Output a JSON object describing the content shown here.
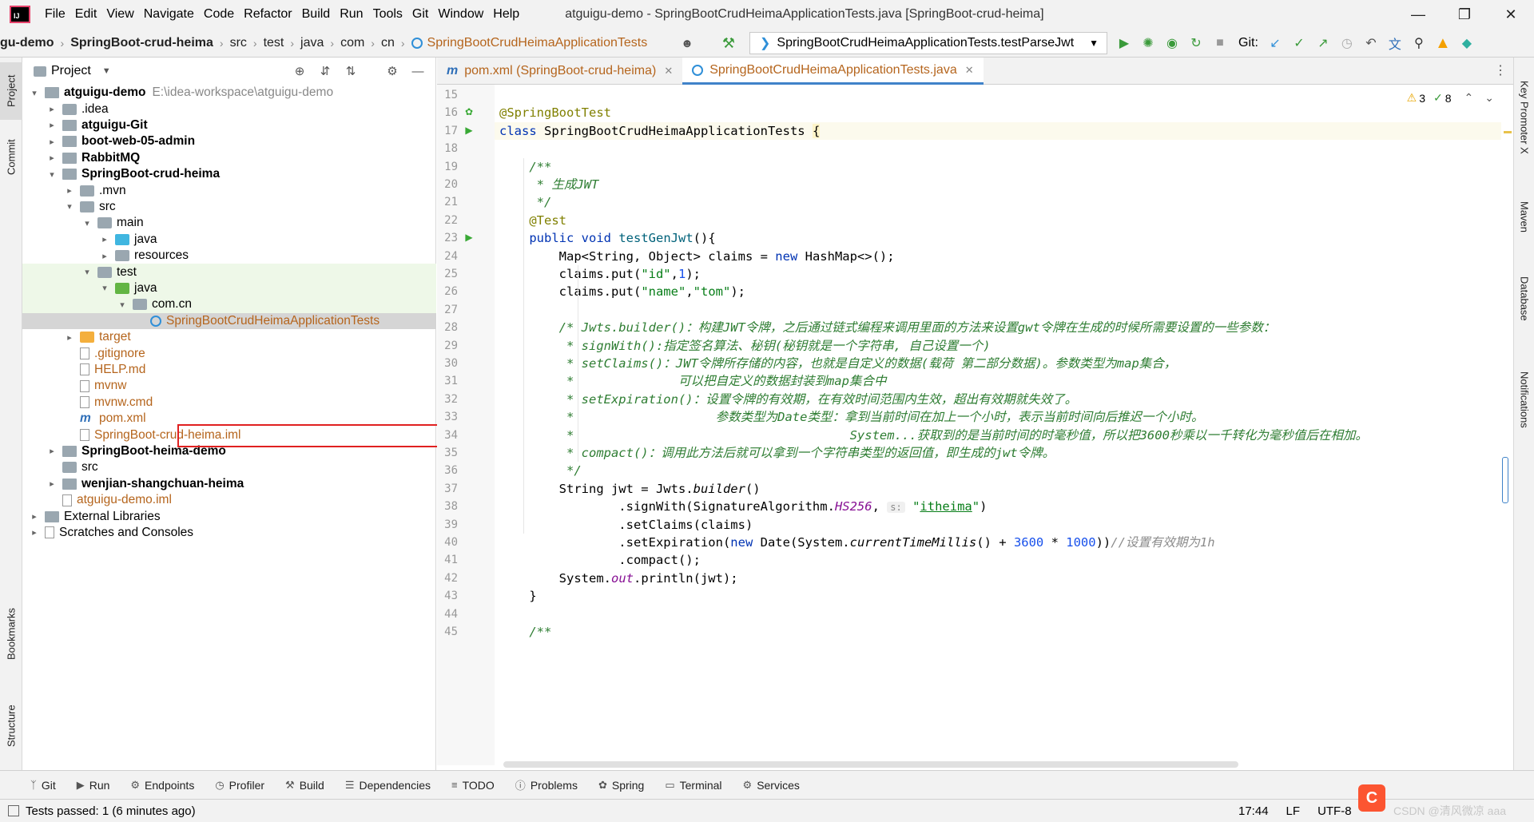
{
  "titlebar": {
    "menus": [
      "File",
      "Edit",
      "View",
      "Navigate",
      "Code",
      "Refactor",
      "Build",
      "Run",
      "Tools",
      "Git",
      "Window",
      "Help"
    ],
    "title": "atguigu-demo - SpringBootCrudHeimaApplicationTests.java [SpringBoot-crud-heima]"
  },
  "breadcrumb": {
    "items": [
      "gu-demo",
      "SpringBoot-crud-heima",
      "src",
      "test",
      "java",
      "com",
      "cn",
      "SpringBootCrudHeimaApplicationTests"
    ]
  },
  "toolbar": {
    "run_config": "SpringBootCrudHeimaApplicationTests.testParseJwt",
    "git_label": "Git:"
  },
  "left_stripe": [
    "Project",
    "Commit",
    "Bookmarks",
    "Structure"
  ],
  "right_stripe": [
    "Key Promoter X",
    "Maven",
    "Database",
    "Notifications"
  ],
  "project": {
    "header": "Project",
    "tree": [
      {
        "label": "atguigu-demo",
        "path": "E:\\idea-workspace\\atguigu-demo",
        "bold": true,
        "icon": "module",
        "arrow": "▾"
      },
      {
        "label": ".idea",
        "icon": "folder",
        "arrow": "▸"
      },
      {
        "label": "atguigu-Git",
        "bold": true,
        "icon": "module",
        "arrow": "▸"
      },
      {
        "label": "boot-web-05-admin",
        "bold": true,
        "icon": "module",
        "arrow": "▸"
      },
      {
        "label": "RabbitMQ",
        "bold": true,
        "icon": "module",
        "arrow": "▸"
      },
      {
        "label": "SpringBoot-crud-heima",
        "bold": true,
        "icon": "module",
        "arrow": "▾"
      },
      {
        "label": ".mvn",
        "icon": "folder",
        "arrow": "▸"
      },
      {
        "label": "src",
        "icon": "folder",
        "arrow": "▾"
      },
      {
        "label": "main",
        "icon": "folder",
        "arrow": "▾"
      },
      {
        "label": "java",
        "icon": "folder-blue",
        "arrow": "▸"
      },
      {
        "label": "resources",
        "icon": "folder",
        "arrow": "▸"
      },
      {
        "label": "test",
        "icon": "folder",
        "arrow": "▾"
      },
      {
        "label": "java",
        "icon": "folder-green",
        "arrow": "▾"
      },
      {
        "label": "com.cn",
        "icon": "package",
        "arrow": "▾"
      },
      {
        "label": "SpringBootCrudHeimaApplicationTests",
        "icon": "java-class",
        "arrow": "",
        "selected": true
      },
      {
        "label": "target",
        "icon": "folder-orange",
        "arrow": "▸",
        "orange": true
      },
      {
        "label": ".gitignore",
        "icon": "file",
        "arrow": "",
        "orange": true
      },
      {
        "label": "HELP.md",
        "icon": "file",
        "arrow": "",
        "orange": true
      },
      {
        "label": "mvnw",
        "icon": "file",
        "arrow": "",
        "orange": true
      },
      {
        "label": "mvnw.cmd",
        "icon": "file",
        "arrow": "",
        "orange": true
      },
      {
        "label": "pom.xml",
        "icon": "maven",
        "arrow": "",
        "orange": true
      },
      {
        "label": "SpringBoot-crud-heima.iml",
        "icon": "file",
        "arrow": "",
        "orange": true
      },
      {
        "label": "SpringBoot-heima-demo",
        "bold": true,
        "icon": "module",
        "arrow": "▸"
      },
      {
        "label": "src",
        "icon": "folder",
        "arrow": ""
      },
      {
        "label": "wenjian-shangchuan-heima",
        "bold": true,
        "icon": "module",
        "arrow": "▸"
      },
      {
        "label": "atguigu-demo.iml",
        "icon": "file",
        "arrow": "",
        "orange": true
      },
      {
        "label": "External Libraries",
        "icon": "library",
        "arrow": "▸"
      },
      {
        "label": "Scratches and Consoles",
        "icon": "scratch",
        "arrow": "▸"
      }
    ]
  },
  "editor": {
    "tabs": [
      {
        "label": "pom.xml (SpringBoot-crud-heima)",
        "active": false
      },
      {
        "label": "SpringBootCrudHeimaApplicationTests.java",
        "active": true
      }
    ],
    "inspections": {
      "warnings": "3",
      "checks": "8"
    },
    "lines": [
      {
        "n": "15",
        "html": ""
      },
      {
        "n": "16",
        "html": "<span class='ann'>@SpringBootTest</span>"
      },
      {
        "n": "17",
        "html": "<span class='kw'>class</span> SpringBootCrudHeimaApplicationTests <span style='background:#fff4c8'>{</span>"
      },
      {
        "n": "18",
        "html": ""
      },
      {
        "n": "19",
        "html": "    <span class='jdoc'>/**</span>"
      },
      {
        "n": "20",
        "html": "<span class='jdoc'>     * 生成JWT</span>"
      },
      {
        "n": "21",
        "html": "<span class='jdoc'>     */</span>"
      },
      {
        "n": "22",
        "html": "    <span class='ann'>@Test</span>"
      },
      {
        "n": "23",
        "html": "    <span class='kw'>public void</span> <span style='color:#00627a'>testGenJwt</span>(){"
      },
      {
        "n": "24",
        "html": "        Map&lt;String, Object&gt; claims = <span class='kw'>new</span> HashMap&lt;&gt;();"
      },
      {
        "n": "25",
        "html": "        claims.put(<span class='str'>\"id\"</span>,<span class='num'>1</span>);"
      },
      {
        "n": "26",
        "html": "        claims.put(<span class='str'>\"name\"</span>,<span class='str'>\"tom\"</span>);"
      },
      {
        "n": "27",
        "html": ""
      },
      {
        "n": "28",
        "html": "<span class='jdoc'>        /* Jwts.builder()：构建JWT令牌，之后通过链式编程来调用里面的方法来设置gwt令牌在生成的时候所需要设置的一些参数：</span>"
      },
      {
        "n": "29",
        "html": "<span class='jdoc'>         * signWith():指定签名算法、秘钥(秘钥就是一个字符串, 自己设置一个)</span>"
      },
      {
        "n": "30",
        "html": "<span class='jdoc'>         * setClaims()：JWT令牌所存储的内容，也就是自定义的数据(载荷 第二部分数据)。参数类型为map集合，</span>"
      },
      {
        "n": "31",
        "html": "<span class='jdoc'>         *              可以把自定义的数据封装到map集合中</span>"
      },
      {
        "n": "32",
        "html": "<span class='jdoc'>         * setExpiration()：设置令牌的有效期，在有效时间范围内生效，超出有效期就失效了。</span>"
      },
      {
        "n": "33",
        "html": "<span class='jdoc'>         *                   参数类型为Date类型：拿到当前时间在加上一个小时，表示当前时间向后推迟一个小时。</span>"
      },
      {
        "n": "34",
        "html": "<span class='jdoc'>         *                                     System...获取到的是当前时间的时毫秒值，所以把3600秒乘以一千转化为毫秒值后在相加。</span>"
      },
      {
        "n": "35",
        "html": "<span class='jdoc'>         * compact()：调用此方法后就可以拿到一个字符串类型的返回值，即生成的jwt令牌。</span>"
      },
      {
        "n": "36",
        "html": "<span class='jdoc'>         */</span>"
      },
      {
        "n": "37",
        "html": "        String jwt = Jwts.<i>builder</i>()"
      },
      {
        "n": "38",
        "html": "                .signWith(SignatureAlgorithm.<span class='fld'>HS256</span>, <span class='hint'>s:</span> <span class='str'>\"<u>itheima</u>\"</span>)"
      },
      {
        "n": "39",
        "html": "                .setClaims(claims)"
      },
      {
        "n": "40",
        "html": "                .setExpiration(<span class='kw'>new</span> Date(System.<i>currentTimeMillis</i>() + <span class='num'>3600</span> * <span class='num'>1000</span>))<span class='cmt'>//设置有效期为1h</span>"
      },
      {
        "n": "41",
        "html": "                .compact();"
      },
      {
        "n": "42",
        "html": "        System.<span class='fld'>out</span>.println(jwt);"
      },
      {
        "n": "43",
        "html": "    }"
      },
      {
        "n": "44",
        "html": ""
      },
      {
        "n": "45",
        "html": "    <span class='jdoc'>/**</span>"
      }
    ]
  },
  "bottom_tools": [
    "Git",
    "Run",
    "Endpoints",
    "Profiler",
    "Build",
    "Dependencies",
    "TODO",
    "Problems",
    "Spring",
    "Terminal",
    "Services"
  ],
  "status": {
    "message": "Tests passed: 1 (6 minutes ago)",
    "position": "17:44",
    "line_sep": "LF",
    "encoding": "UTF-8",
    "watermark": "CSDN @清风微凉 aaa"
  }
}
